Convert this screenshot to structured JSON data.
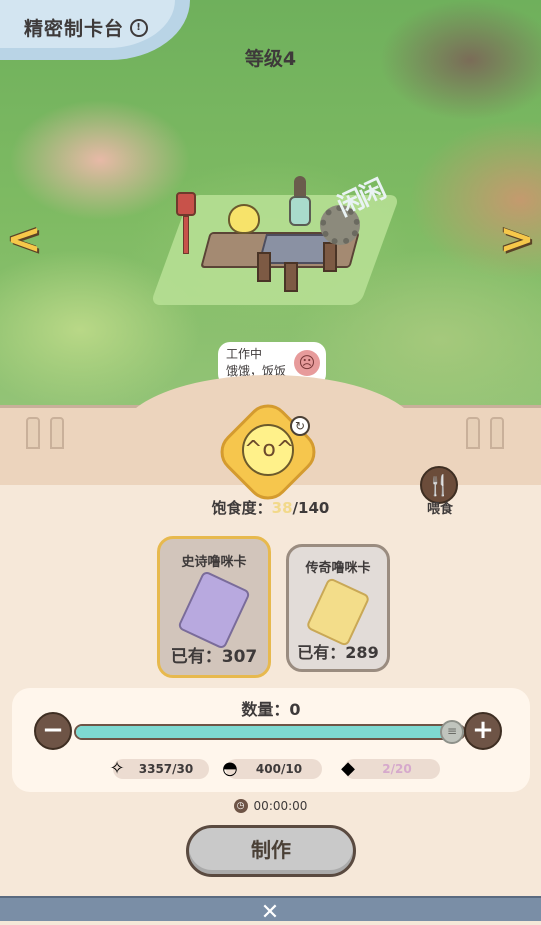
{
  "header": {
    "title": "精密制卡台",
    "level": "等级4"
  },
  "scene": {
    "idle_text": "闲",
    "bubble_status": "工作中",
    "bubble_message": "饿饿，饭饭"
  },
  "pet": {
    "satiety_label": "饱食度：",
    "satiety_current": "38",
    "satiety_max": "/140",
    "feed_label": "喂食"
  },
  "cards": [
    {
      "name": "史诗噜咪卡",
      "owned": "已有：307",
      "selected": true
    },
    {
      "name": "传奇噜咪卡",
      "owned": "已有：289",
      "selected": false
    }
  ],
  "quantity": {
    "label": "数量：0",
    "slider_fraction": 1.0
  },
  "resources": [
    {
      "icon": "star-crystal-icon",
      "value": "3357/30"
    },
    {
      "icon": "purple-slime-icon",
      "value": "400/10"
    },
    {
      "icon": "green-cube-icon",
      "value": "2/20"
    }
  ],
  "timer": "00:00:00",
  "make_button": "制作",
  "colors": {
    "accent": "#f6c84a",
    "slider": "#7ed9d1",
    "selected_border": "#e7b94e"
  }
}
